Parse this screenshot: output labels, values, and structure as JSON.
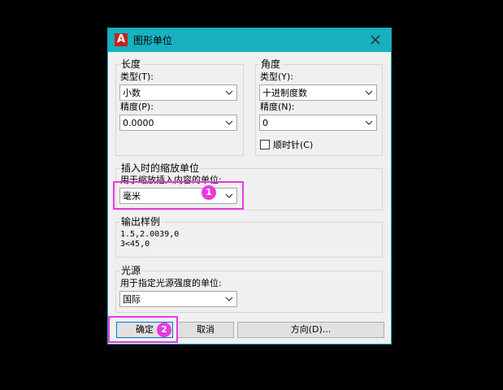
{
  "window": {
    "title": "图形单位",
    "app_icon_letter": "A"
  },
  "length": {
    "group_title": "长度",
    "type_label": "类型(T):",
    "type_value": "小数",
    "precision_label": "精度(P):",
    "precision_value": "0.0000"
  },
  "angle": {
    "group_title": "角度",
    "type_label": "类型(Y):",
    "type_value": "十进制度数",
    "precision_label": "精度(N):",
    "precision_value": "0",
    "clockwise_label": "顺时针(C)",
    "clockwise_checked": false
  },
  "insertion": {
    "group_title": "插入时的缩放单位",
    "desc": "用于缩放插入内容的单位:",
    "value": "毫米"
  },
  "output": {
    "group_title": "输出样例",
    "line1": "1.5,2.0039,0",
    "line2": "3<45,0"
  },
  "lighting": {
    "group_title": "光源",
    "desc": "用于指定光源强度的单位:",
    "value": "国际"
  },
  "buttons": {
    "ok": "确定",
    "cancel": "取消",
    "direction": "方向(D)..."
  },
  "annotations": {
    "badge1": "1",
    "badge2": "2",
    "color": "#e83adf"
  },
  "colors": {
    "titlebar": "#17b0bf",
    "dialog_bg": "#f0f0f0",
    "default_button_border": "#0078d7"
  }
}
